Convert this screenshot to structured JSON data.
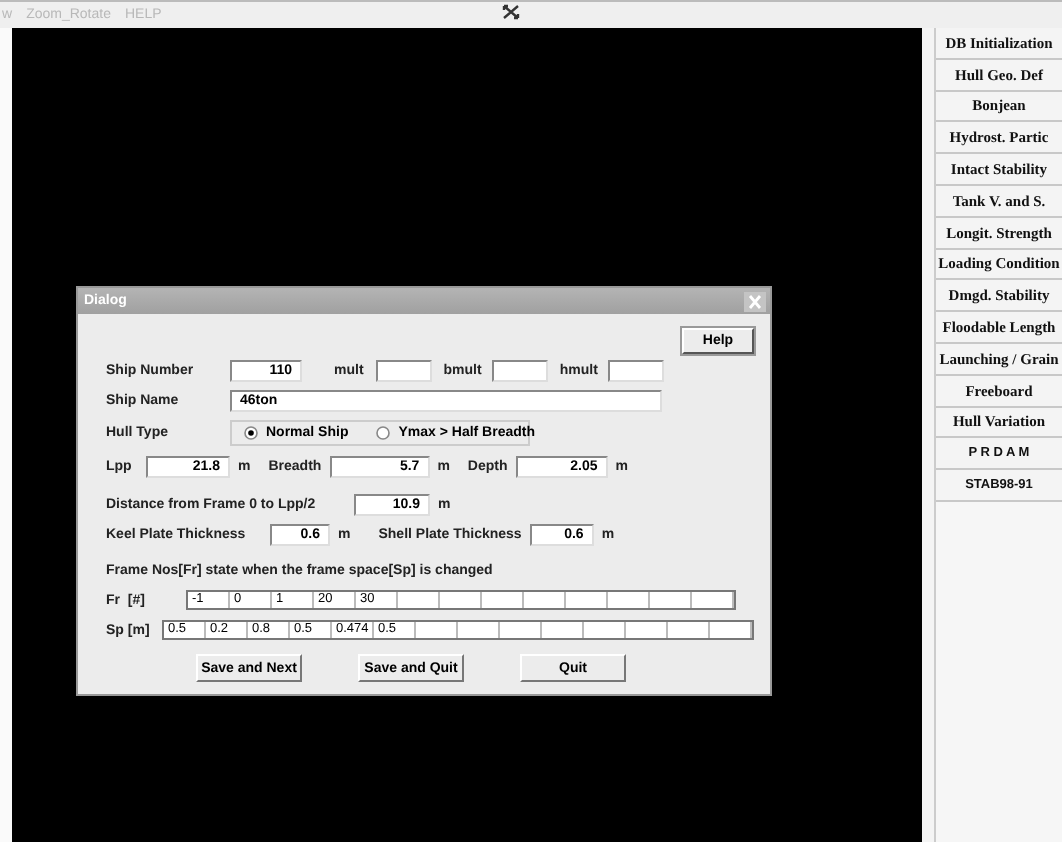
{
  "menu": [
    {
      "label": "w"
    },
    {
      "label": "Zoom_Rotate"
    },
    {
      "label": "HELP"
    }
  ],
  "side_buttons": [
    {
      "label": "DB Initialization",
      "kind": "serif"
    },
    {
      "label": "Hull Geo. Def",
      "kind": "serif"
    },
    {
      "label": "Bonjean",
      "kind": "serif"
    },
    {
      "label": "Hydrost. Partic",
      "kind": "serif"
    },
    {
      "label": "Intact Stability",
      "kind": "serif"
    },
    {
      "label": "Tank V. and S.",
      "kind": "serif"
    },
    {
      "label": "Longit. Strength",
      "kind": "serif"
    },
    {
      "label": "Loading Condition",
      "kind": "serif"
    },
    {
      "label": "Dmgd. Stability",
      "kind": "serif"
    },
    {
      "label": "Floodable Length",
      "kind": "serif"
    },
    {
      "label": "Launching / Grain",
      "kind": "serif"
    },
    {
      "label": "Freeboard",
      "kind": "serif"
    },
    {
      "label": "Hull Variation",
      "kind": "serif"
    },
    {
      "label": "P R D A M",
      "kind": "sans"
    },
    {
      "label": "STAB98-91",
      "kind": "sans"
    }
  ],
  "dialog": {
    "title": "Dialog",
    "help": "Help",
    "ship_number": {
      "label": "Ship Number",
      "value": "110"
    },
    "mult": {
      "label": "mult"
    },
    "bmult": {
      "label": "bmult"
    },
    "hmult": {
      "label": "hmult"
    },
    "ship_name": {
      "label": "Ship Name",
      "value": "46ton"
    },
    "hull_type": {
      "label": "Hull Type",
      "options": [
        {
          "label": "Normal Ship",
          "selected": true
        },
        {
          "label": "Ymax > Half Breadth",
          "selected": false
        }
      ]
    },
    "lpp": {
      "label": "Lpp",
      "value": "21.8",
      "unit": "m"
    },
    "breadth": {
      "label": "Breadth",
      "value": "5.7",
      "unit": "m"
    },
    "depth": {
      "label": "Depth",
      "value": "2.05",
      "unit": "m"
    },
    "distance": {
      "label": "Distance from Frame 0 to Lpp/2",
      "value": "10.9",
      "unit": "m"
    },
    "keel": {
      "label": "Keel Plate Thickness",
      "value": "0.6",
      "unit": "m"
    },
    "shell": {
      "label": "Shell Plate Thickness",
      "value": "0.6",
      "unit": "m"
    },
    "frame_note": "Frame Nos[Fr] state when the frame space[Sp] is changed",
    "fr": {
      "label": "Fr  [#]",
      "values": [
        "-1",
        "0",
        "1",
        "20",
        "30"
      ]
    },
    "sp": {
      "label": "Sp [m]",
      "values": [
        "0.5",
        "0.2",
        "0.8",
        "0.5",
        "0.474",
        "0.5"
      ]
    },
    "buttons": [
      "Save and Next",
      "Save and Quit",
      "Quit"
    ]
  }
}
